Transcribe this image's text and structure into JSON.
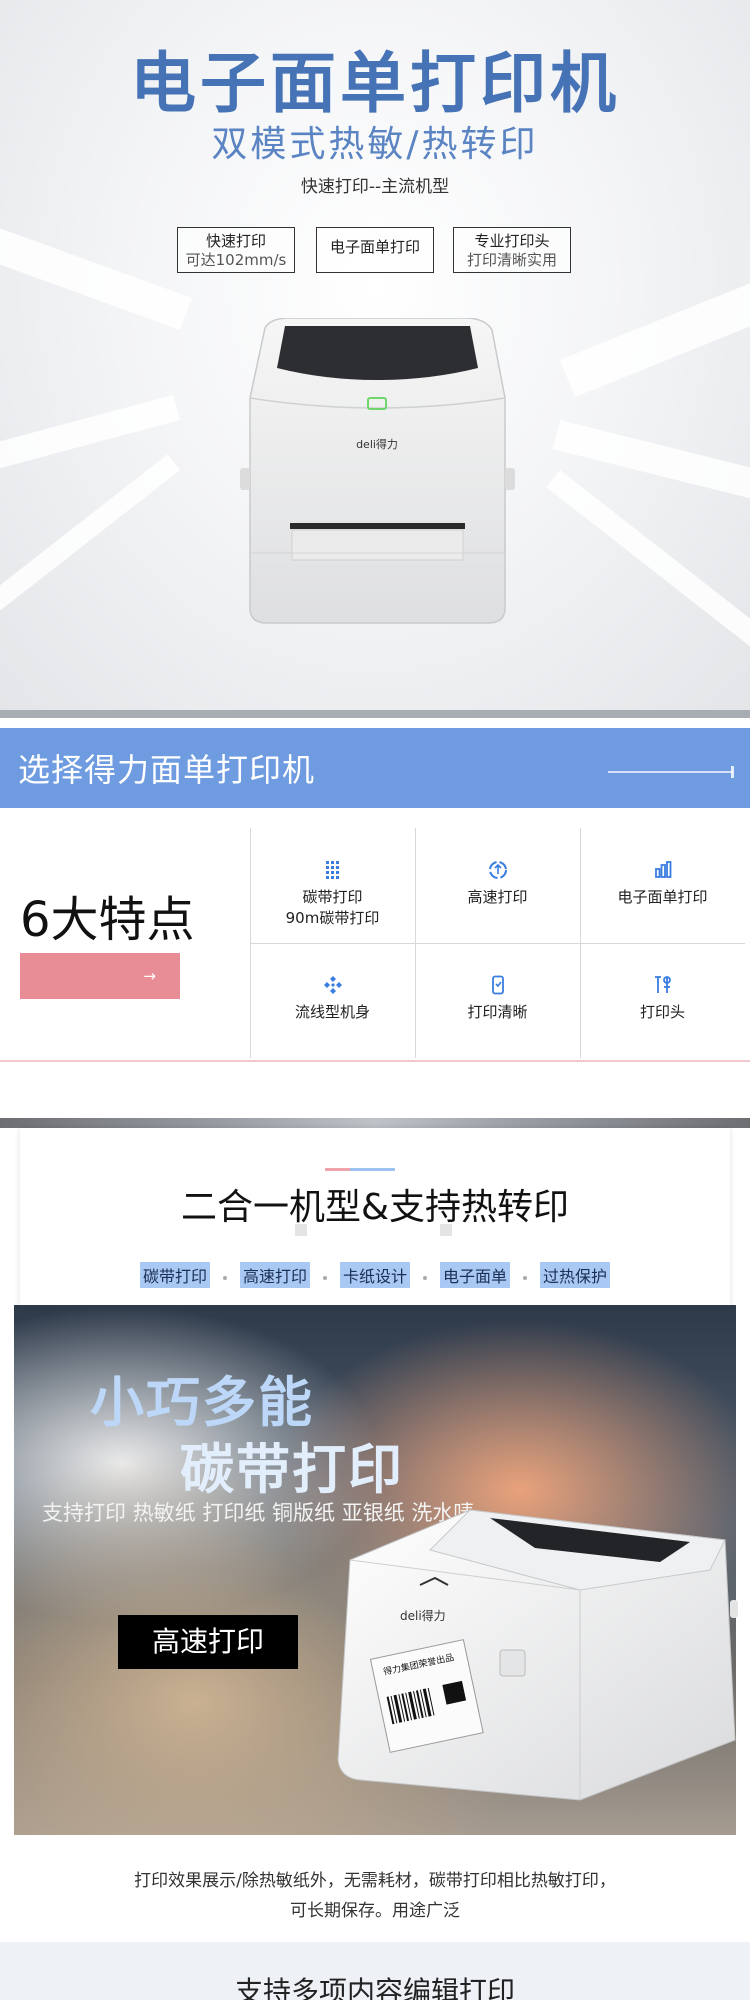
{
  "hero": {
    "title": "电子面单打印机",
    "subtitle": "双模式热敏/热转印",
    "tagline": "快速打印--主流机型",
    "badges": [
      {
        "line1": "快速打印",
        "line2": "可达102mm/s"
      },
      {
        "line1": "电子面单打印",
        "line2": ""
      },
      {
        "line1": "专业打印头",
        "line2": "打印清晰实用"
      }
    ],
    "brand": "deli得力"
  },
  "section2": {
    "title": "选择得力面单打印机",
    "features_heading": "6大特点",
    "cta_arrow": "→",
    "features": [
      {
        "icon": "ribbon-grid-icon",
        "label": "碳带打印",
        "sub": "90m碳带打印"
      },
      {
        "icon": "speed-recycle-icon",
        "label": "高速打印",
        "sub": ""
      },
      {
        "icon": "bar-chart-icon",
        "label": "电子面单打印",
        "sub": ""
      },
      {
        "icon": "streamline-body-icon",
        "label": "流线型机身",
        "sub": ""
      },
      {
        "icon": "phone-clear-icon",
        "label": "打印清晰",
        "sub": ""
      },
      {
        "icon": "print-head-icon",
        "label": "打印头",
        "sub": ""
      }
    ]
  },
  "section3": {
    "title": "二合一机型&支持热转印",
    "tags": [
      "碳带打印",
      "高速打印",
      "卡纸设计",
      "电子面单",
      "过热保护"
    ],
    "photo": {
      "headline1": "小巧多能",
      "headline2": "碳带打印",
      "support": "支持打印 热敏纸 打印纸 铜版纸 亚银纸 洗水唛",
      "button": "高速打印",
      "brand": "deli得力",
      "label_text": "得力集团荣誉出品"
    },
    "desc_line1": "打印效果展示/除热敏纸外，无需耗材，碳带打印相比热敏打印，",
    "desc_line2": "可长期保存。用途广泛"
  },
  "section4": {
    "title": "支持多项内容编辑打印"
  },
  "colors": {
    "accent_blue": "#4673b6",
    "band_blue": "#6f9be0",
    "pink": "#e88d95",
    "tag_blue": "#a9c8f4"
  }
}
